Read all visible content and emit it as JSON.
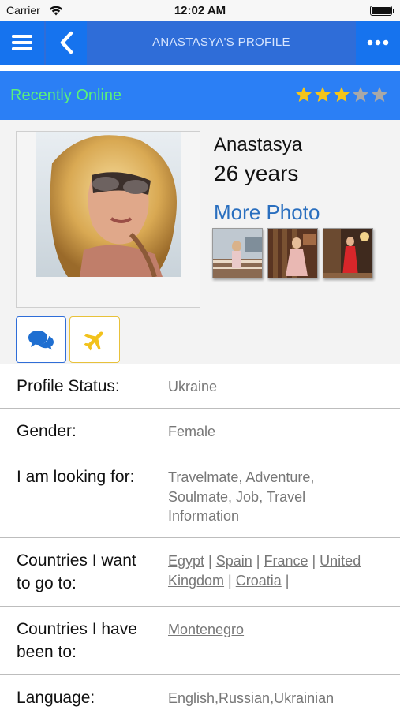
{
  "status_bar": {
    "carrier": "Carrier",
    "time": "12:02 AM"
  },
  "nav": {
    "title": "ANASTASYA'S PROFILE",
    "menu_icon": "hamburger-menu-icon",
    "back_icon": "chevron-left-icon",
    "more_icon": "ellipsis-icon"
  },
  "online": {
    "status": "Recently Online",
    "rating": 3,
    "rating_max": 5
  },
  "profile": {
    "name": "Anastasya",
    "age": "26 years",
    "more_photo": "More Photo",
    "thumbnails": 3
  },
  "actions": {
    "chat_icon": "chat-bubbles-icon",
    "travel_icon": "airplane-icon"
  },
  "details": {
    "status": {
      "label": "Profile Status:",
      "value": "Ukraine"
    },
    "gender": {
      "label": "Gender:",
      "value": "Female"
    },
    "looking_for": {
      "label": "I am looking for:",
      "value": "Travelmate, Adventure, Soulmate, Job, Travel Information"
    },
    "countries_want": {
      "label_line1": "Countries I want",
      "label_line2": "to go to:",
      "items": [
        "Egypt",
        "Spain",
        "France",
        "United Kingdom",
        "Croatia"
      ]
    },
    "countries_been": {
      "label_line1": "Countries I have",
      "label_line2": "been to:",
      "items": [
        "Montenegro"
      ]
    },
    "language": {
      "label": "Language:",
      "value": "English,Russian,Ukrainian"
    }
  },
  "colors": {
    "nav_blue": "#2f6dd8",
    "strip_blue": "#2b7ff5",
    "online_green": "#5bf07a",
    "star_gold": "#f5c518",
    "star_gray": "#a8a8a8",
    "link_blue": "#2a6fbf"
  }
}
